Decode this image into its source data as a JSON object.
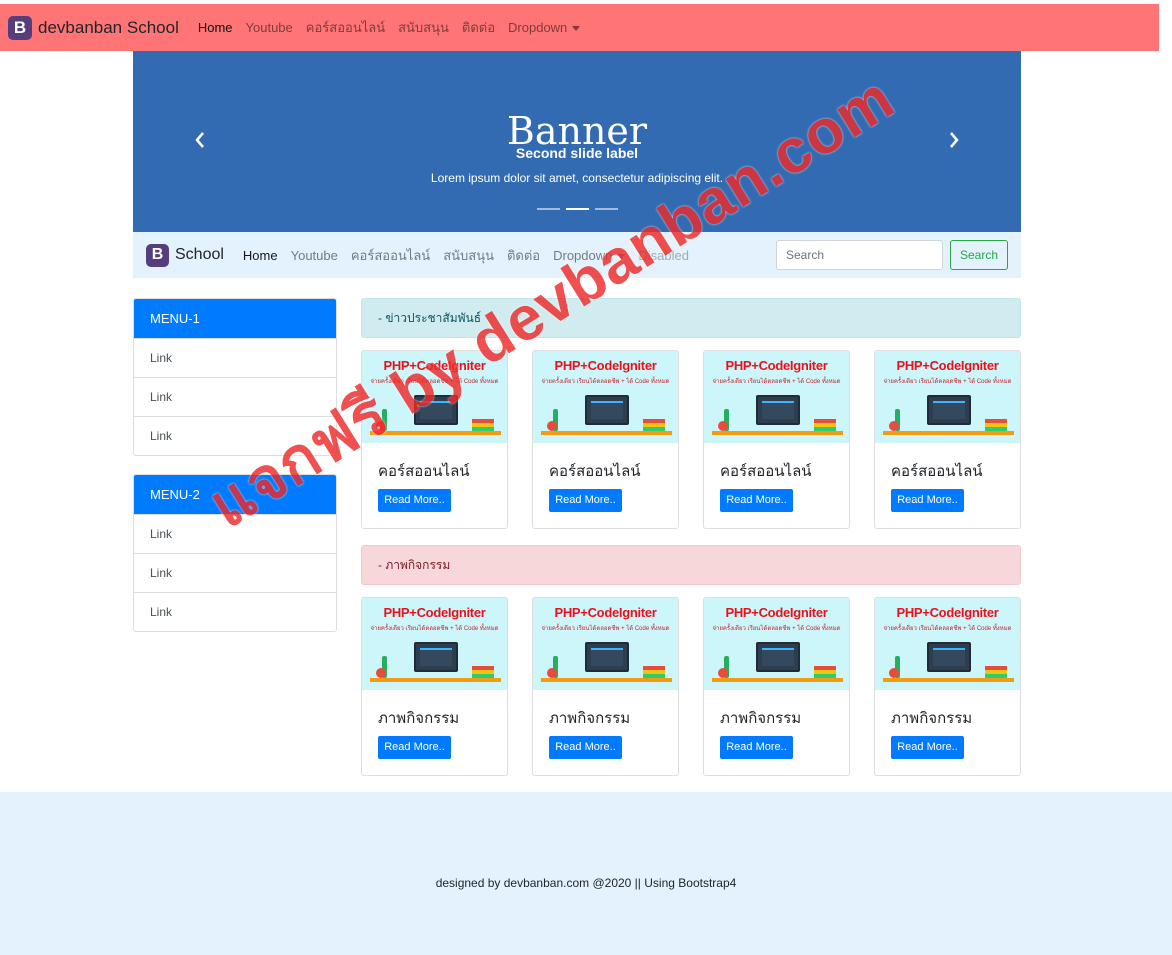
{
  "top_nav": {
    "brand_logo": "B",
    "brand": "devbanban School",
    "items": [
      "Home",
      "Youtube",
      "คอร์สออนไลน์",
      "สนับสนุน",
      "ติดต่อ",
      "Dropdown"
    ]
  },
  "banner": {
    "text": "Banner",
    "caption_title": "Second slide label",
    "caption_text": "Lorem ipsum dolor sit amet, consectetur adipiscing elit.",
    "prev_icon": "chevron-left-icon",
    "next_icon": "chevron-right-icon",
    "active_slide": 2,
    "slide_count": 3
  },
  "sub_nav": {
    "brand_logo": "B",
    "brand": "School",
    "items": [
      "Home",
      "Youtube",
      "คอร์สออนไลน์",
      "สนับสนุน",
      "ติดต่อ",
      "Dropdown",
      "Disabled"
    ],
    "search_placeholder": "Search",
    "search_button": "Search"
  },
  "sidebar": {
    "menu1": {
      "title": "MENU-1",
      "links": [
        "Link",
        "Link",
        "Link"
      ]
    },
    "menu2": {
      "title": "MENU-2",
      "links": [
        "Link",
        "Link",
        "Link"
      ]
    }
  },
  "sections": {
    "news_title": "- ข่าวประชาสัมพันธ์",
    "activity_title": "- ภาพกิจกรรม"
  },
  "card_image": {
    "title": "PHP+CodeIgniter",
    "subtitle": "จ่ายครั้งเดียว เรียนได้ตลอดชีพ + ได้ Code ทั้งหมด"
  },
  "news_cards": [
    {
      "title": "คอร์สออนไลน์",
      "button": "Read More.."
    },
    {
      "title": "คอร์สออนไลน์",
      "button": "Read More.."
    },
    {
      "title": "คอร์สออนไลน์",
      "button": "Read More.."
    },
    {
      "title": "คอร์สออนไลน์",
      "button": "Read More.."
    }
  ],
  "activity_cards": [
    {
      "title": "ภาพกิจกรรม",
      "button": "Read More.."
    },
    {
      "title": "ภาพกิจกรรม",
      "button": "Read More.."
    },
    {
      "title": "ภาพกิจกรรม",
      "button": "Read More.."
    },
    {
      "title": "ภาพกิจกรรม",
      "button": "Read More.."
    }
  ],
  "footer": {
    "text": "designed by devbanban.com @2020 || Using Bootstrap4"
  },
  "watermark": {
    "text": "แจกฟรี by devbanban.com"
  },
  "colors": {
    "top_nav_bg": "#ff7575",
    "banner_bg": "#336bb3",
    "sub_nav_bg": "#e3f2fd",
    "primary": "#007bff",
    "success": "#28a745",
    "info_alert": "#d1ecf1",
    "danger_alert": "#f8d7da",
    "watermark": "#ee2a2a"
  }
}
